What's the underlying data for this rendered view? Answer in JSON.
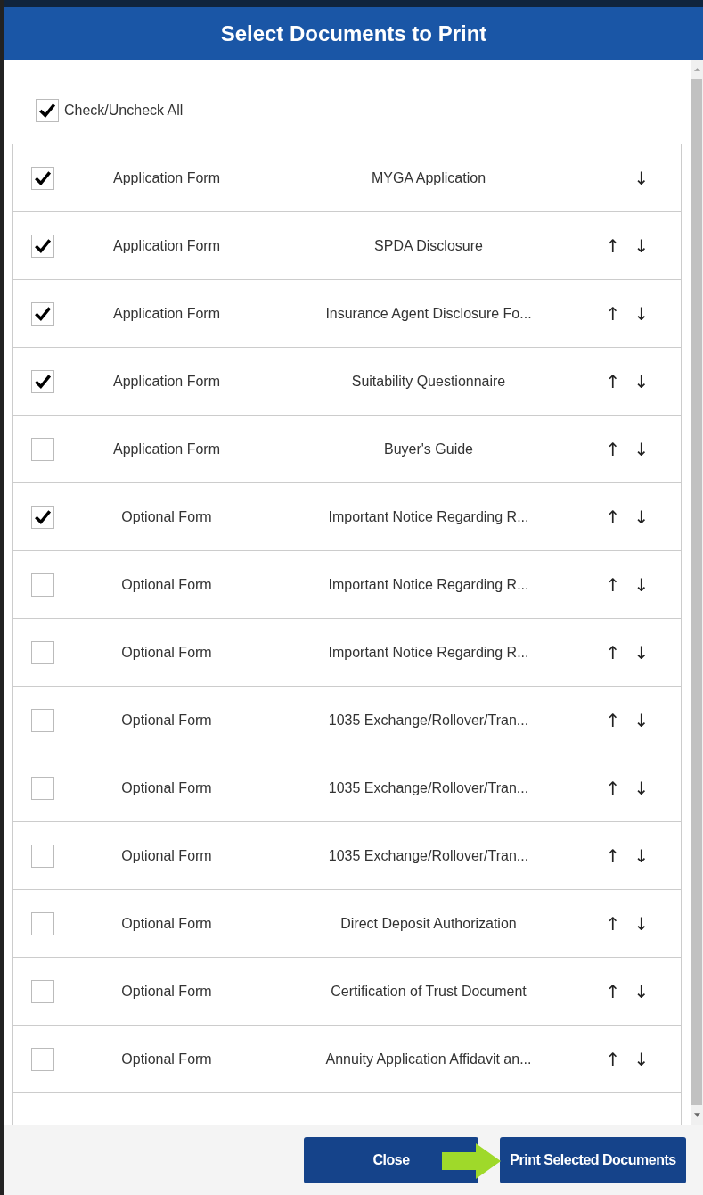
{
  "dialog": {
    "title": "Select Documents to Print"
  },
  "check_all": {
    "label": "Check/Uncheck All",
    "checked": true
  },
  "documents": [
    {
      "type": "Application Form",
      "name": "MYGA Application",
      "checked": true,
      "move_down": "↓"
    },
    {
      "type": "Application Form",
      "name": "SPDA Disclosure",
      "checked": true,
      "move_up": "↑",
      "move_down": "↓"
    },
    {
      "type": "Application Form",
      "name": "Insurance Agent Disclosure Fo...",
      "checked": true,
      "move_up": "↑",
      "move_down": "↓"
    },
    {
      "type": "Application Form",
      "name": "Suitability Questionnaire",
      "checked": true,
      "move_up": "↑",
      "move_down": "↓"
    },
    {
      "type": "Application Form",
      "name": "Buyer's Guide",
      "checked": false,
      "move_up": "↑",
      "move_down": "↓"
    },
    {
      "type": "Optional Form",
      "name": "Important Notice Regarding R...",
      "checked": true,
      "move_up": "↑",
      "move_down": "↓"
    },
    {
      "type": "Optional Form",
      "name": "Important Notice Regarding R...",
      "checked": false,
      "move_up": "↑",
      "move_down": "↓"
    },
    {
      "type": "Optional Form",
      "name": "Important Notice Regarding R...",
      "checked": false,
      "move_up": "↑",
      "move_down": "↓"
    },
    {
      "type": "Optional Form",
      "name": "1035 Exchange/Rollover/Tran...",
      "checked": false,
      "move_up": "↑",
      "move_down": "↓"
    },
    {
      "type": "Optional Form",
      "name": "1035 Exchange/Rollover/Tran...",
      "checked": false,
      "move_up": "↑",
      "move_down": "↓"
    },
    {
      "type": "Optional Form",
      "name": "1035 Exchange/Rollover/Tran...",
      "checked": false,
      "move_up": "↑",
      "move_down": "↓"
    },
    {
      "type": "Optional Form",
      "name": "Direct Deposit Authorization",
      "checked": false,
      "move_up": "↑",
      "move_down": "↓"
    },
    {
      "type": "Optional Form",
      "name": "Certification of Trust Document",
      "checked": false,
      "move_up": "↑",
      "move_down": "↓"
    },
    {
      "type": "Optional Form",
      "name": "Annuity Application Affidavit an...",
      "checked": false,
      "move_up": "↑",
      "move_down": "↓"
    }
  ],
  "buttons": [
    {
      "label": "Close",
      "kind": "close"
    },
    {
      "label": "Print Selected Documents",
      "kind": "print"
    }
  ]
}
